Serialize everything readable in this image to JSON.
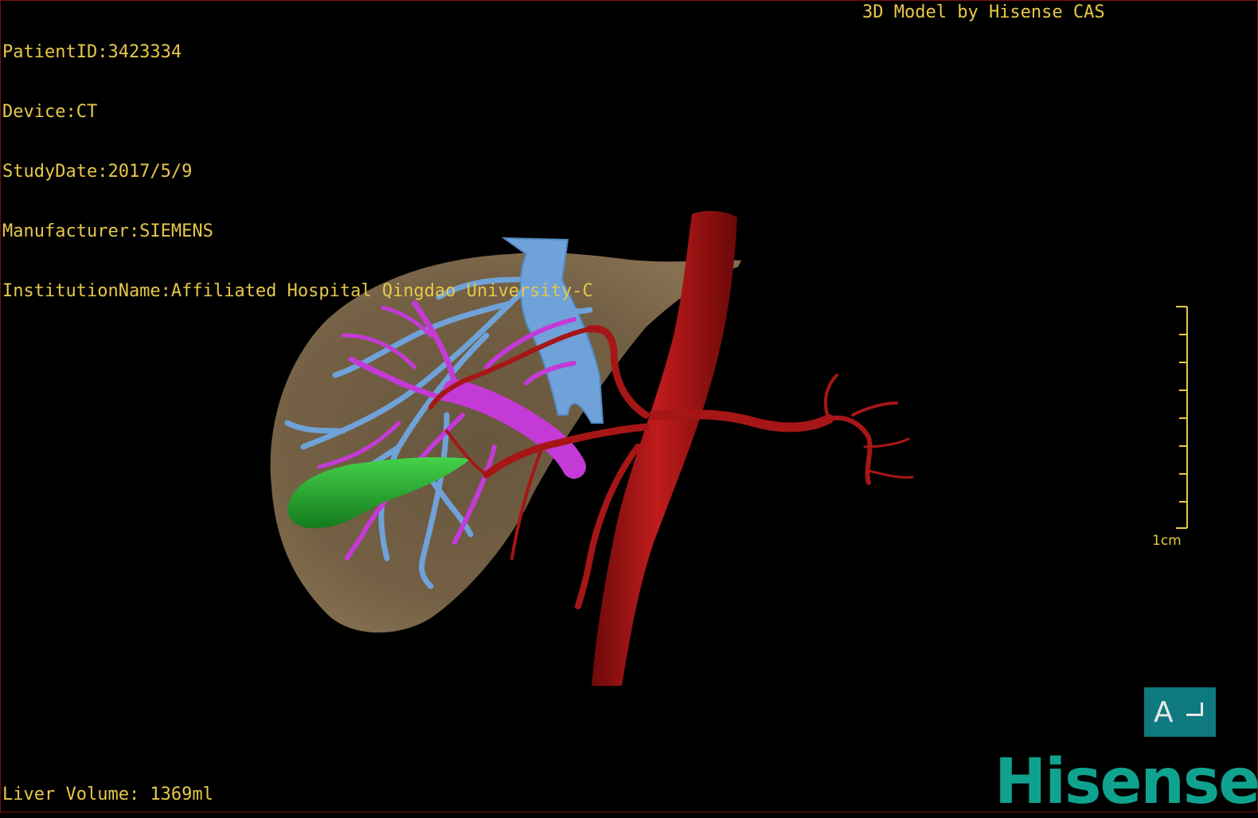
{
  "overlay": {
    "patient_id": "PatientID:3423334",
    "device": "Device:CT",
    "study_date": "StudyDate:2017/5/9",
    "manufacturer": "Manufacturer:SIEMENS",
    "institution": "InstitutionName:Affiliated Hospital Qingdao University-C",
    "vendor": "3D Model by Hisense CAS",
    "liver_volume": "Liver Volume: 1369ml"
  },
  "scale_bar": {
    "label": "1cm"
  },
  "orientation_widget": {
    "label": "A"
  },
  "logo": {
    "text": "Hisense"
  },
  "colors": {
    "overlay_text": "#e6c84a",
    "liver": "#7a6548",
    "hepatic_vein": "#6fa2d8",
    "portal_vein": "#c43ad6",
    "gallbladder": "#1fa82a",
    "artery": "#a11414",
    "logo": "#0fa38f",
    "orientation_box": "#0e7a80"
  },
  "icons": {
    "orientation": "orientation-cube-icon"
  }
}
